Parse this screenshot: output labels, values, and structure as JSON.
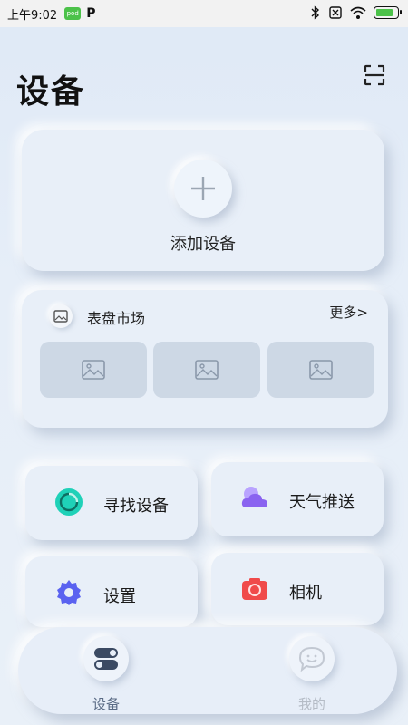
{
  "status_bar": {
    "time": "上午9:02",
    "app_icon_text": "pod",
    "app2_text": "P"
  },
  "header": {
    "title": "设备",
    "scan_icon": "scan-icon"
  },
  "add_device": {
    "label": "添加设备",
    "icon": "plus-icon"
  },
  "watchface_market": {
    "title": "表盘市场",
    "more_label": "更多>",
    "thumbnails": [
      "image-icon",
      "image-icon",
      "image-icon"
    ]
  },
  "tiles": [
    {
      "label": "寻找设备",
      "icon": "find-device-icon",
      "color": "#1fd1b8"
    },
    {
      "label": "天气推送",
      "icon": "weather-cloud-icon",
      "color": "#8a63f0"
    },
    {
      "label": "设置",
      "icon": "gear-icon",
      "color": "#5a62f0"
    },
    {
      "label": "相机",
      "icon": "camera-icon",
      "color": "#f04a4a"
    }
  ],
  "bottom_nav": {
    "items": [
      {
        "label": "设备",
        "icon": "device-toggle-icon",
        "active": true
      },
      {
        "label": "我的",
        "icon": "chat-bubble-icon",
        "active": false
      }
    ]
  },
  "colors": {
    "background": "#e6eef8",
    "card": "#e8eff8",
    "thumbnail": "#cdd8e5",
    "battery": "#4cc24a"
  }
}
